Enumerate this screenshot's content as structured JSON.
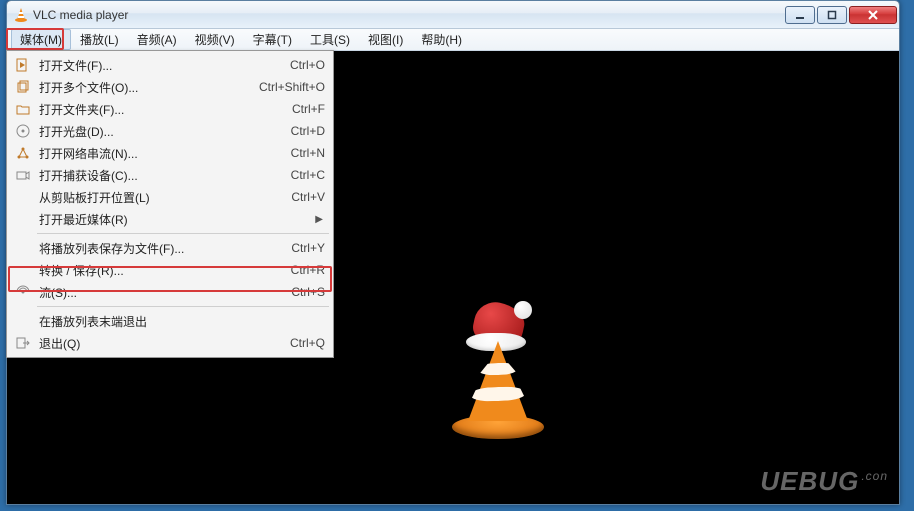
{
  "window": {
    "title": "VLC media player"
  },
  "menubar": {
    "items": [
      {
        "label": "媒体(M)"
      },
      {
        "label": "播放(L)"
      },
      {
        "label": "音频(A)"
      },
      {
        "label": "视频(V)"
      },
      {
        "label": "字幕(T)"
      },
      {
        "label": "工具(S)"
      },
      {
        "label": "视图(I)"
      },
      {
        "label": "帮助(H)"
      }
    ]
  },
  "media_menu": {
    "open_file": {
      "label": "打开文件(F)...",
      "shortcut": "Ctrl+O"
    },
    "open_multiple": {
      "label": "打开多个文件(O)...",
      "shortcut": "Ctrl+Shift+O"
    },
    "open_folder": {
      "label": "打开文件夹(F)...",
      "shortcut": "Ctrl+F"
    },
    "open_disc": {
      "label": "打开光盘(D)...",
      "shortcut": "Ctrl+D"
    },
    "open_network": {
      "label": "打开网络串流(N)...",
      "shortcut": "Ctrl+N"
    },
    "open_capture": {
      "label": "打开捕获设备(C)...",
      "shortcut": "Ctrl+C"
    },
    "open_clipboard": {
      "label": "从剪贴板打开位置(L)",
      "shortcut": "Ctrl+V"
    },
    "open_recent": {
      "label": "打开最近媒体(R)",
      "submenu": true
    },
    "save_playlist": {
      "label": "将播放列表保存为文件(F)...",
      "shortcut": "Ctrl+Y"
    },
    "convert": {
      "label": "转换 / 保存(R)...",
      "shortcut": "Ctrl+R"
    },
    "stream": {
      "label": "流(S)...",
      "shortcut": "Ctrl+S"
    },
    "quit_at_end": {
      "label": "在播放列表末端退出"
    },
    "quit": {
      "label": "退出(Q)",
      "shortcut": "Ctrl+Q"
    }
  },
  "watermark": {
    "text": "UEBUG",
    "suffix": ".con"
  }
}
